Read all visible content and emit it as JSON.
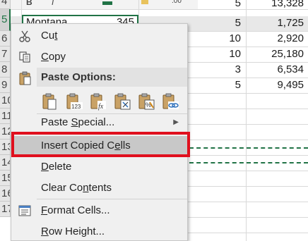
{
  "sheet": {
    "row_numbers": [
      "4",
      "5",
      "6",
      "7",
      "8",
      "9",
      "10",
      "11",
      "12",
      "13",
      "14",
      "15",
      "16",
      "17"
    ],
    "active_cell_value": "Montana",
    "rows": [
      {
        "b": "",
        "c": "5",
        "d": "13,328"
      },
      {
        "b": "345",
        "c": "5",
        "d": "1,725"
      },
      {
        "b": "",
        "c": "10",
        "d": "2,920"
      },
      {
        "b": "",
        "c": "10",
        "d": "25,180"
      },
      {
        "b": "",
        "c": "3",
        "d": "6,534"
      },
      {
        "b": "",
        "c": "5",
        "d": "9,495"
      }
    ],
    "accent_color": "#217346"
  },
  "menu": {
    "cut": {
      "pre": "Cu",
      "ul": "t",
      "post": ""
    },
    "copy": {
      "pre": "",
      "ul": "C",
      "post": "opy"
    },
    "paste_options": "Paste Options:",
    "paste_icons": [
      "paste-icon",
      "paste-values-icon",
      "paste-formulas-icon",
      "paste-transpose-icon",
      "paste-formatting-icon",
      "paste-link-icon"
    ],
    "paste_special": {
      "pre": "Paste ",
      "ul": "S",
      "post": "pecial..."
    },
    "insert_copied_cells": {
      "pre": "Insert Copied C",
      "ul": "e",
      "post": "lls"
    },
    "delete": {
      "pre": "",
      "ul": "D",
      "post": "elete"
    },
    "clear_contents": {
      "pre": "Clear Co",
      "ul": "n",
      "post": "tents"
    },
    "format_cells": {
      "pre": "",
      "ul": "F",
      "post": "ormat Cells..."
    },
    "row_height": {
      "pre": "",
      "ul": "R",
      "post": "ow Height..."
    },
    "highlight_color": "#e0101e"
  }
}
